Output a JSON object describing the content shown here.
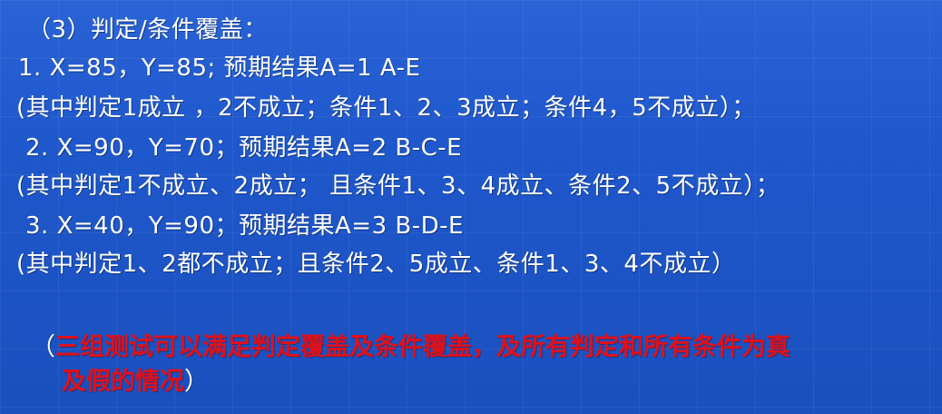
{
  "title": "（3）判定/条件覆盖：",
  "cases": [
    {
      "line": "1.  X=85，Y=85; 预期结果A=1 A-E",
      "detail": "(其中判定1成立 ，2不成立；条件1、2、3成立；条件4，5不成立）；"
    },
    {
      "line": " 2.   X=90，Y=70；预期结果A=2  B-C-E",
      "detail": "(其中判定1不成立、2成立；   且条件1、3、4成立、条件2、5不成立）；"
    },
    {
      "line": " 3.   X=40，Y=90；预期结果A=3  B-D-E",
      "detail": "(其中判定1、2都不成立；且条件2、5成立、条件1、3、4不成立）"
    }
  ],
  "note": {
    "open_paren": "（",
    "text_line1": "三组测试可以满足判定覆盖及条件覆盖，及所有判定和所有条件为真",
    "text_line2": "及假的情况",
    "close_paren": "）"
  },
  "colors": {
    "background": "#1f55c4",
    "text": "#ffffff",
    "highlight": "#e0101a"
  }
}
